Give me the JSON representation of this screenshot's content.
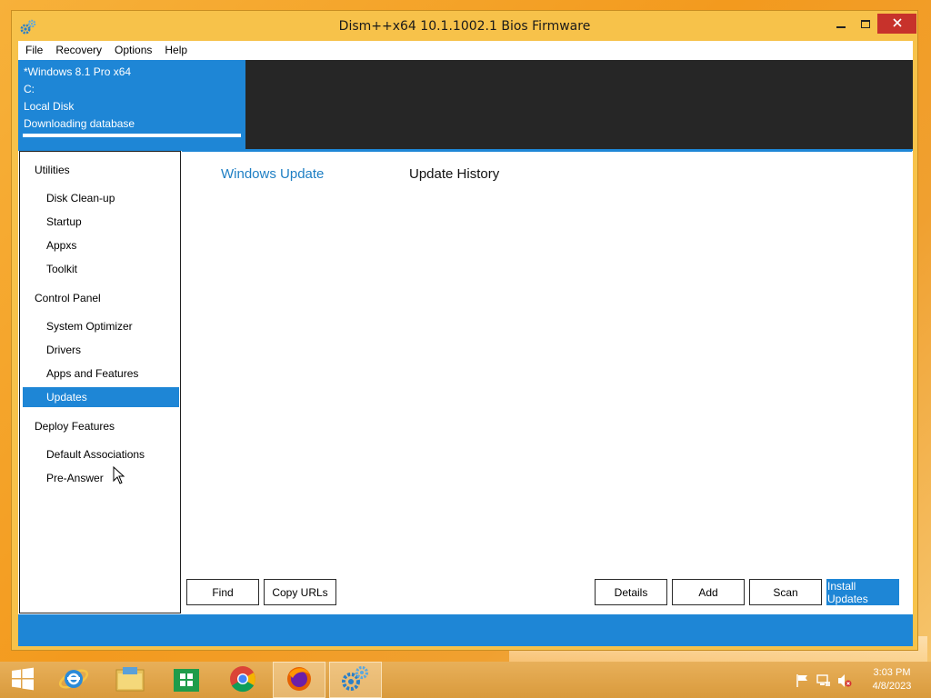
{
  "window": {
    "title": "Dism++x64 10.1.1002.1 Bios Firmware"
  },
  "menu": [
    "File",
    "Recovery",
    "Options",
    "Help"
  ],
  "image_info": {
    "os": "*Windows 8.1 Pro x64",
    "drive": "C:",
    "disk": "Local Disk",
    "status": "Downloading database",
    "progress": 1.0
  },
  "sidebar": {
    "items": [
      {
        "label": "Utilities",
        "type": "section"
      },
      {
        "label": "Disk Clean-up",
        "type": "child"
      },
      {
        "label": "Startup",
        "type": "child"
      },
      {
        "label": "Appxs",
        "type": "child"
      },
      {
        "label": "Toolkit",
        "type": "child"
      },
      {
        "label": "Control Panel",
        "type": "section"
      },
      {
        "label": "System Optimizer",
        "type": "child"
      },
      {
        "label": "Drivers",
        "type": "child"
      },
      {
        "label": "Apps and Features",
        "type": "child"
      },
      {
        "label": "Updates",
        "type": "child",
        "selected": true
      },
      {
        "label": "Deploy Features",
        "type": "section"
      },
      {
        "label": "Default Associations",
        "type": "child"
      },
      {
        "label": "Pre-Answer",
        "type": "child"
      }
    ]
  },
  "tabs": {
    "active": "Windows Update",
    "inactive": "Update History"
  },
  "buttons": {
    "find": "Find",
    "copy_urls": "Copy URLs",
    "details": "Details",
    "add": "Add",
    "scan": "Scan",
    "install": "Install Updates"
  },
  "taskbar": {
    "time": "3:03 PM",
    "date": "4/8/2023",
    "apps": [
      "start-icon",
      "internet-explorer-icon",
      "file-explorer-icon",
      "store-icon",
      "chrome-icon",
      "firefox-icon",
      "dism-icon"
    ]
  },
  "colors": {
    "accent": "#1e86d6",
    "dark_panel": "#262626",
    "window_frame": "#f7c24a",
    "close_button": "#c7322b"
  }
}
